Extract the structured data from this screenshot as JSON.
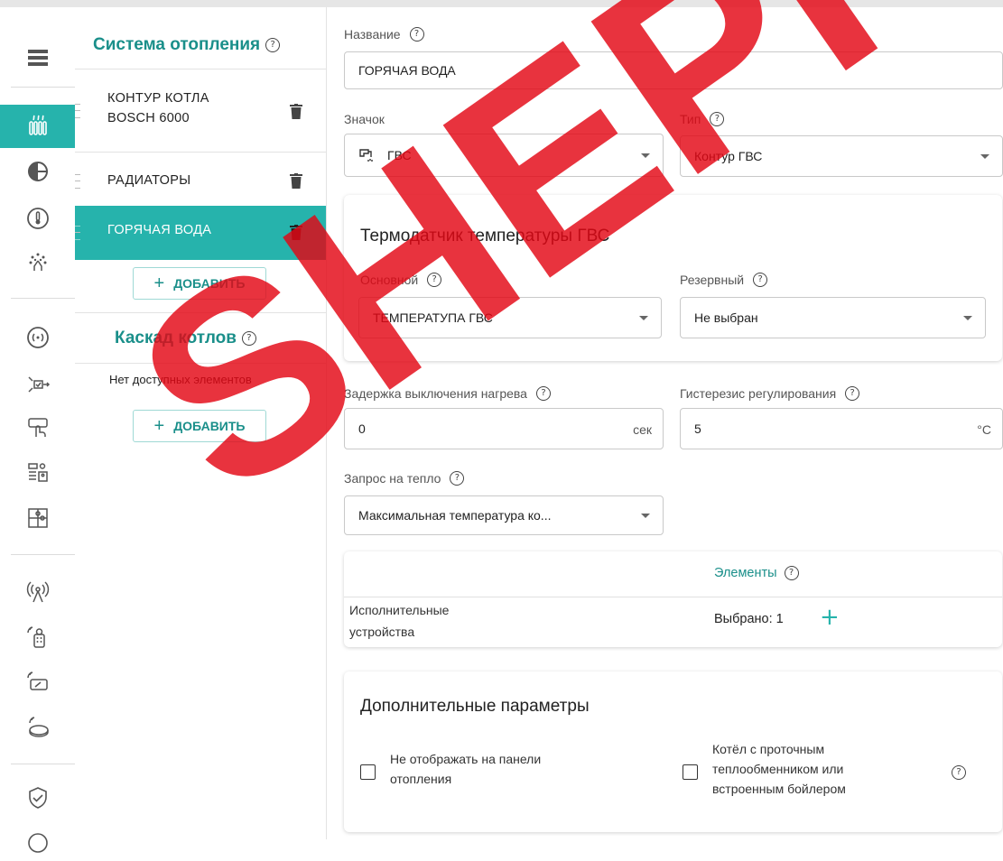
{
  "sidebar": {
    "title": "Система отопления",
    "items": [
      {
        "label_line1": "КОНТУР КОТЛА",
        "label_line2": "BOSCH 6000"
      },
      {
        "label_line1": "РАДИАТОРЫ"
      },
      {
        "label_line1": "ГОРЯЧАЯ ВОДА"
      }
    ],
    "add_label": "ДОБАВИТЬ",
    "cascade_title": "Каскад котлов",
    "cascade_empty": "Нет доступных элементов",
    "cascade_add_label": "ДОБАВИТЬ"
  },
  "form": {
    "name_label": "Название",
    "name_value": "ГОРЯЧАЯ ВОДА",
    "icon_label": "Значок",
    "icon_value": "ГВС",
    "type_label": "Тип",
    "type_value": "Контур ГВС",
    "sensor_card": {
      "title": "Термодатчик температуры ГВС",
      "main_label": "Основной",
      "main_value": "ТЕМПЕРАТУПА ГВС",
      "reserve_label": "Резервный",
      "reserve_value": "Не выбран"
    },
    "delay_label": "Задержка выключения нагрева",
    "delay_value": "0",
    "delay_unit": "сек",
    "hyst_label": "Гистерезис регулирования",
    "hyst_value": "5",
    "hyst_unit": "°C",
    "heat_request_label": "Запрос на тепло",
    "heat_request_value": "Максимальная температура ко..."
  },
  "elements_card": {
    "header": "Элементы",
    "row_label_line1": "Исполнительные",
    "row_label_line2": "устройства",
    "row_value": "Выбрано: 1"
  },
  "extra_card": {
    "title": "Дополнительные параметры",
    "opt1_line1": "Не отображать на панели",
    "opt1_line2": "отопления",
    "opt2_line1": "Котёл с проточным",
    "opt2_line2": "теплообменником или",
    "opt2_line3": "встроенным бойлером"
  },
  "watermark": {
    "text": "SHEPI",
    "color": "#e30613"
  },
  "colors": {
    "accent": "#26b3ac",
    "accent_text": "#1a8f8a"
  },
  "help_glyph": "?"
}
